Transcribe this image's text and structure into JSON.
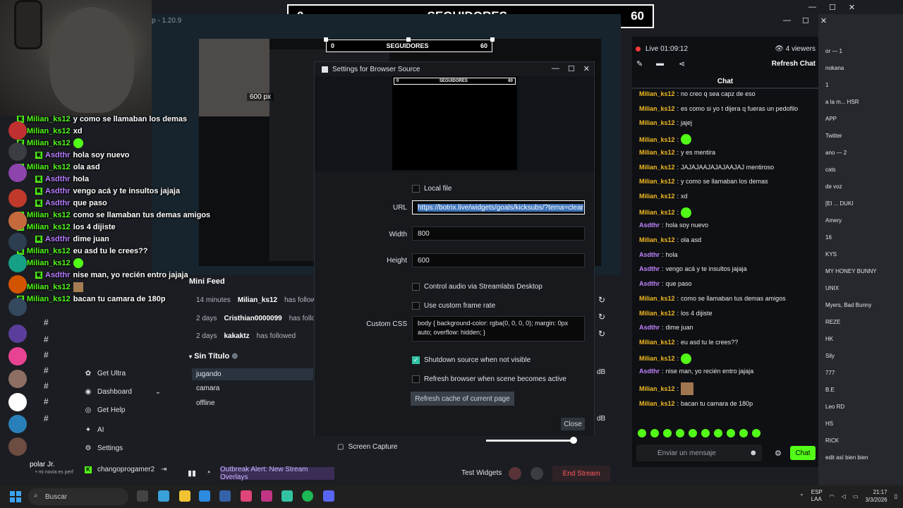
{
  "goal_bar": {
    "left": "0",
    "title": "SEGUIDORES",
    "right": "60"
  },
  "editor": {
    "version": "p - 1.20.9",
    "size_label": "600 px",
    "overlay_user": "rick"
  },
  "left_overlay": [
    {
      "user": "Milian_ks12",
      "msg": "y como se llamaban los demas",
      "kind": "milian"
    },
    {
      "user": "Milian_ks12",
      "msg": "xd",
      "kind": "milian"
    },
    {
      "user": "Milian_ks12",
      "msg": "",
      "kind": "milian",
      "emote": true
    },
    {
      "user": "Asdthr",
      "msg": "hola soy nuevo",
      "kind": "asdthr"
    },
    {
      "user": "Milian_ks12",
      "msg": "ola asd",
      "kind": "milian"
    },
    {
      "user": "Asdthr",
      "msg": "hola",
      "kind": "asdthr"
    },
    {
      "user": "Asdthr",
      "msg": "vengo acá y te insultos jajaja",
      "kind": "asdthr"
    },
    {
      "user": "Asdthr",
      "msg": "que paso",
      "kind": "asdthr"
    },
    {
      "user": "Milian_ks12",
      "msg": "como se llamaban tus demas amigos",
      "kind": "milian"
    },
    {
      "user": "Milian_ks12",
      "msg": "los 4 dijiste",
      "kind": "milian"
    },
    {
      "user": "Asdthr",
      "msg": "dime juan",
      "kind": "asdthr"
    },
    {
      "user": "Milian_ks12",
      "msg": "eu asd tu le crees??",
      "kind": "milian"
    },
    {
      "user": "Milian_ks12",
      "msg": "",
      "kind": "milian",
      "emote": true
    },
    {
      "user": "Asdthr",
      "msg": "nise man, yo recién entro jajaja",
      "kind": "asdthr"
    },
    {
      "user": "Milian_ks12",
      "msg": "",
      "kind": "milian",
      "cat": true
    },
    {
      "user": "Milian_ks12",
      "msg": "bacan tu camara de 180p",
      "kind": "milian"
    }
  ],
  "nav": {
    "get_ultra": "Get Ultra",
    "dashboard": "Dashboard",
    "get_help": "Get Help",
    "ai": "AI",
    "settings": "Settings",
    "account": "changoprogamer2",
    "bottom_user": "polar Jr.",
    "bottom_sub": "• mi novia es perf"
  },
  "mini_feed": {
    "title": "Mini Feed",
    "rows": [
      {
        "time": "14 minutes",
        "user": "Milian_ks12",
        "action": "has followed"
      },
      {
        "time": "2 days",
        "user": "Cristhian0000099",
        "action": "has followe"
      },
      {
        "time": "2 days",
        "user": "kakaktz",
        "action": "has followed"
      }
    ]
  },
  "scenes": {
    "title": "Sin Título",
    "items": [
      "jugando",
      "camara",
      "offline"
    ]
  },
  "dialog": {
    "title": "Settings for Browser Source",
    "preview_left": "0",
    "preview_title": "SEGUIDORES",
    "preview_right": "60",
    "local_file": "Local file",
    "url_label": "URL",
    "url_value": "https://botrix.live/widgets/goals/kicksubs/?tema=clear",
    "width_label": "Width",
    "width_value": "800",
    "height_label": "Height",
    "height_value": "600",
    "control_audio": "Control audio via Streamlabs Desktop",
    "custom_frame_rate": "Use custom frame rate",
    "css_label": "Custom CSS",
    "css_value": "body { background-color: rgba(0, 0, 0, 0); margin: 0px auto; overflow: hidden; }",
    "shutdown": "Shutdown source when not visible",
    "refresh_active": "Refresh browser when scene becomes active",
    "refresh_cache": "Refresh cache of current page",
    "close": "Close"
  },
  "bottom": {
    "screen_capture": "Screen Capture",
    "outbreak": "Outbreak Alert: New Stream Overlays",
    "test_widgets": "Test Widgets",
    "end_stream": "End Stream",
    "db1": "dB",
    "db2": "dB"
  },
  "chat": {
    "live": "Live 01:09:12",
    "viewers": "4 viewers",
    "refresh": "Refresh Chat",
    "tab": "Chat",
    "placeholder": "Enviar un mensaje",
    "send": "Chat",
    "messages": [
      {
        "user": "Milian_ks12",
        "text": "no creo q sea capz de eso",
        "kind": "n1"
      },
      {
        "user": "Milian_ks12",
        "text": "es como si yo t dijera q fueras un pedofilo",
        "kind": "n1"
      },
      {
        "user": "Milian_ks12",
        "text": "jajej",
        "kind": "n1"
      },
      {
        "user": "Milian_ks12",
        "text": "",
        "kind": "n1",
        "emote": true
      },
      {
        "user": "Milian_ks12",
        "text": "y es mentira",
        "kind": "n1"
      },
      {
        "user": "Milian_ks12",
        "text": "JAJAJAAJAJAJAAJAJ mentiroso",
        "kind": "n1"
      },
      {
        "user": "Milian_ks12",
        "text": "y como se llamaban los demas",
        "kind": "n1"
      },
      {
        "user": "Milian_ks12",
        "text": "xd",
        "kind": "n1"
      },
      {
        "user": "Milian_ks12",
        "text": "",
        "kind": "n1",
        "emote": true
      },
      {
        "user": "Asdthr",
        "text": "hola soy nuevo",
        "kind": "n2"
      },
      {
        "user": "Milian_ks12",
        "text": "ola asd",
        "kind": "n1"
      },
      {
        "user": "Asdthr",
        "text": "hola",
        "kind": "n2"
      },
      {
        "user": "Asdthr",
        "text": "vengo acá y te insultos jajaja",
        "kind": "n2"
      },
      {
        "user": "Asdthr",
        "text": "que paso",
        "kind": "n2"
      },
      {
        "user": "Milian_ks12",
        "text": "como se llamaban tus demas amigos",
        "kind": "n1"
      },
      {
        "user": "Milian_ks12",
        "text": "los 4 dijiste",
        "kind": "n1"
      },
      {
        "user": "Asdthr",
        "text": "dime juan",
        "kind": "n2"
      },
      {
        "user": "Milian_ks12",
        "text": "eu asd tu le crees??",
        "kind": "n1"
      },
      {
        "user": "Milian_ks12",
        "text": "",
        "kind": "n1",
        "emote": true
      },
      {
        "user": "Asdthr",
        "text": "nise man, yo recién entro jajaja",
        "kind": "n2"
      },
      {
        "user": "Milian_ks12",
        "text": "",
        "kind": "n1",
        "cat": true
      },
      {
        "user": "Milian_ks12",
        "text": "bacan tu camara de 180p",
        "kind": "n1"
      }
    ]
  },
  "far_right": [
    "or — 1",
    "nokana",
    "1",
    "a la m... HSR",
    "APP",
    "Twitter",
    "ano — 2",
    "cats",
    "de voz",
    "[El ... DUKI",
    "Amery",
    "16",
    "KYS",
    "MY HONEY BUNNY",
    "UNIX",
    "Myers, Bad Bunny",
    "REZE",
    "HK",
    "Sily",
    "777",
    "B.E",
    "Leo RD",
    "HS",
    "RICK",
    "edit así bien bien"
  ],
  "taskbar": {
    "search": "Buscar",
    "lang": "ESP",
    "lang2": "LAA",
    "time": "21:17",
    "date": "3/3/2026"
  }
}
